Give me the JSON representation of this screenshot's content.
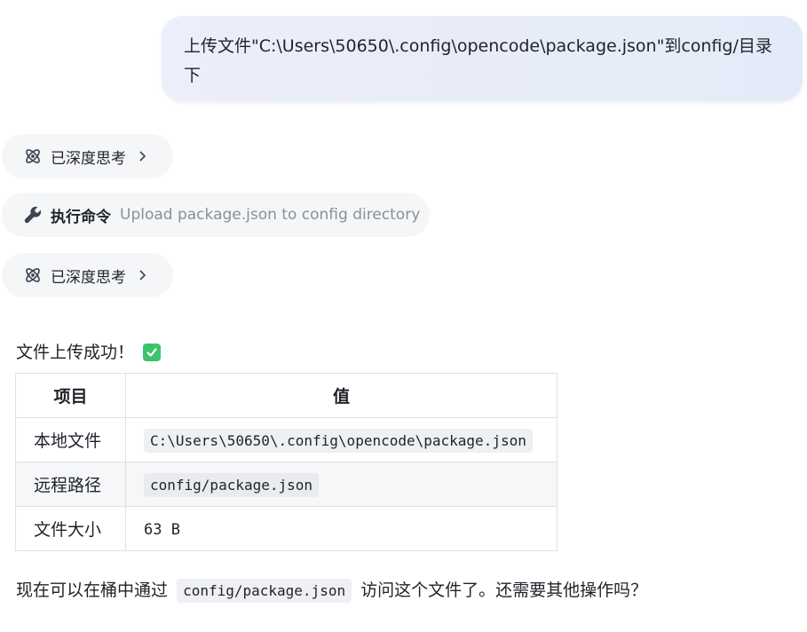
{
  "user_message": {
    "text": "上传文件\"C:\\Users\\50650\\.config\\opencode\\package.json\"到config/目录下"
  },
  "steps": [
    {
      "label": "已深度思考",
      "icon": "atom-icon"
    },
    {
      "label": "执行命令",
      "description": "Upload package.json to config directory",
      "icon": "wrench-icon"
    },
    {
      "label": "已深度思考",
      "icon": "atom-icon"
    }
  ],
  "response": {
    "success_text": "文件上传成功！",
    "success_icon": "check-mark-button-icon",
    "table": {
      "headers": [
        "项目",
        "值"
      ],
      "rows": [
        {
          "key": "本地文件",
          "value": "C:\\Users\\50650\\.config\\opencode\\package.json",
          "code": true
        },
        {
          "key": "远程路径",
          "value": "config/package.json",
          "code": true
        },
        {
          "key": "文件大小",
          "value": "63 B",
          "code": false
        }
      ]
    },
    "closing_before": "现在可以在桶中通过",
    "closing_code": "config/package.json",
    "closing_after": "访问这个文件了。还需要其他操作吗？"
  },
  "colors": {
    "accent_green": "#3cc36b",
    "bubble_bg": "#e8edf9",
    "pill_bg": "#f5f6f8",
    "muted_text": "#8a8f99"
  }
}
